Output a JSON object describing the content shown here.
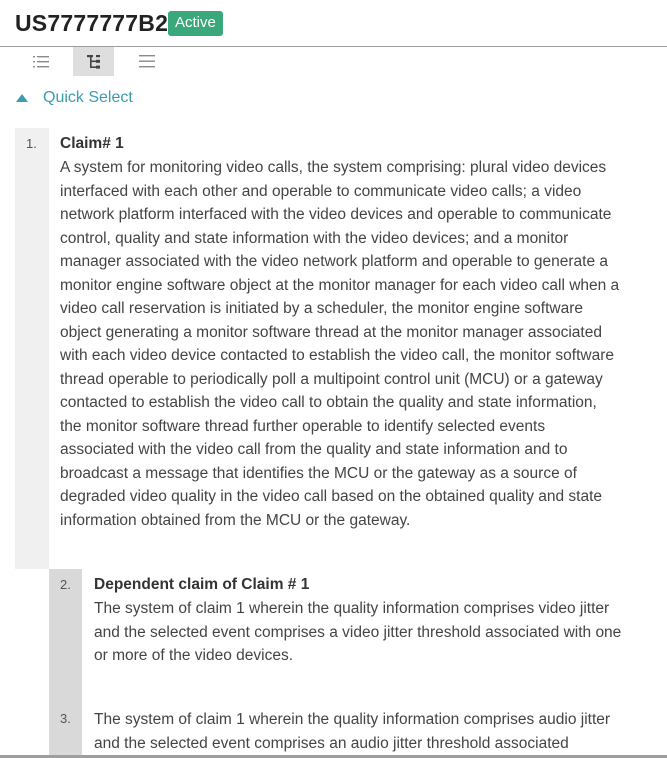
{
  "header": {
    "patent_number": "US7777777B2",
    "status": "Active",
    "status_color": "#3aa87a"
  },
  "toolbar": {
    "buttons": [
      {
        "icon": "list-icon",
        "active": false
      },
      {
        "icon": "tree-icon",
        "active": true
      },
      {
        "icon": "menu-icon",
        "active": false
      }
    ]
  },
  "quick_select": {
    "label": "Quick Select",
    "icon": "triangle-up-icon",
    "color": "#3b9bb0"
  },
  "claims": [
    {
      "number": "1.",
      "heading": "Claim# 1",
      "text": "A system for monitoring video calls, the system comprising: plural video devices interfaced with each other and operable to communicate video calls; a video network platform interfaced with the video devices and operable to communicate control, quality and state information with the video devices; and a monitor manager associated with the video network platform and operable to generate a monitor engine software object at the monitor manager for each video call when a video call reservation is initiated by a scheduler, the monitor engine software object generating a monitor software thread at the monitor manager associated with each video device contacted to establish the video call, the monitor software thread operable to periodically poll a multipoint control unit (MCU) or a gateway contacted to establish the video call to obtain the quality and state information, the monitor software thread further operable to identify selected events associated with the video call from the quality and state information and to broadcast a message that identifies the MCU or the gateway as a source of degraded video quality in the video call based on the obtained quality and state information obtained from the MCU or the gateway."
    },
    {
      "number": "2.",
      "heading": "Dependent claim of Claim # 1",
      "text": "The system of claim 1 wherein the quality information comprises video jitter and the selected event comprises a video jitter threshold associated with one or more of the video devices."
    },
    {
      "number": "3.",
      "heading": "",
      "text": "The system of claim 1 wherein the quality information comprises audio jitter and the selected event comprises an audio jitter threshold associated"
    }
  ]
}
